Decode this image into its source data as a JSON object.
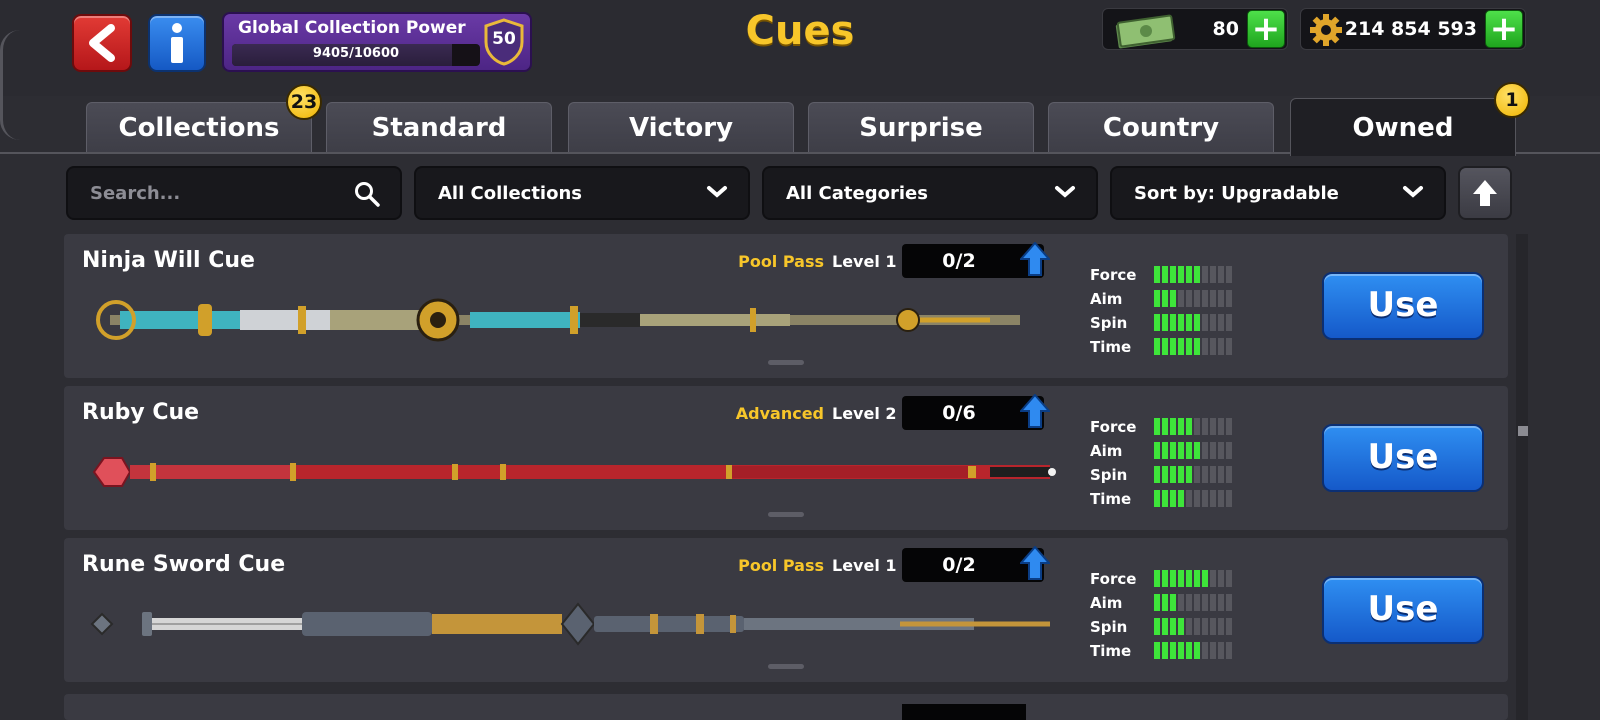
{
  "header": {
    "title": "Cues",
    "collection_power": {
      "label": "Global Collection Power",
      "progress_text": "9405/10600",
      "progress_fraction": 0.887,
      "level": "50"
    },
    "currencies": [
      {
        "name": "cash",
        "icon": "cash-icon",
        "value": "80",
        "add_label": "+"
      },
      {
        "name": "coins",
        "icon": "coin-gear-icon",
        "value": "214 854 593",
        "add_label": "+"
      }
    ]
  },
  "tabs": [
    {
      "label": "Collections",
      "badge": "23"
    },
    {
      "label": "Standard"
    },
    {
      "label": "Victory"
    },
    {
      "label": "Surprise"
    },
    {
      "label": "Country"
    },
    {
      "label": "Owned",
      "badge": "1",
      "active": true
    }
  ],
  "filters": {
    "search_placeholder": "Search...",
    "collections": "All Collections",
    "categories": "All Categories",
    "sort": "Sort by: Upgradable"
  },
  "cues": [
    {
      "name": "Ninja Will Cue",
      "category": "Pool Pass",
      "level": "Level 1",
      "progress": "0/2",
      "stats": {
        "Force": 6,
        "Aim": 3,
        "Spin": 6,
        "Time": 6
      },
      "action": "Use"
    },
    {
      "name": "Ruby Cue",
      "category": "Advanced",
      "level": "Level 2",
      "progress": "0/6",
      "stats": {
        "Force": 5,
        "Aim": 6,
        "Spin": 5,
        "Time": 4
      },
      "action": "Use"
    },
    {
      "name": "Rune Sword Cue",
      "category": "Pool Pass",
      "level": "Level 1",
      "progress": "0/2",
      "stats": {
        "Force": 7,
        "Aim": 3,
        "Spin": 4,
        "Time": 6
      },
      "action": "Use"
    }
  ],
  "stat_labels": [
    "Force",
    "Aim",
    "Spin",
    "Time"
  ],
  "stat_max": 10,
  "colors": {
    "accent_gold": "#f7c62a",
    "use_button": "#1f70dd",
    "stat_on": "#3ee53a",
    "background": "#2d2d33"
  }
}
